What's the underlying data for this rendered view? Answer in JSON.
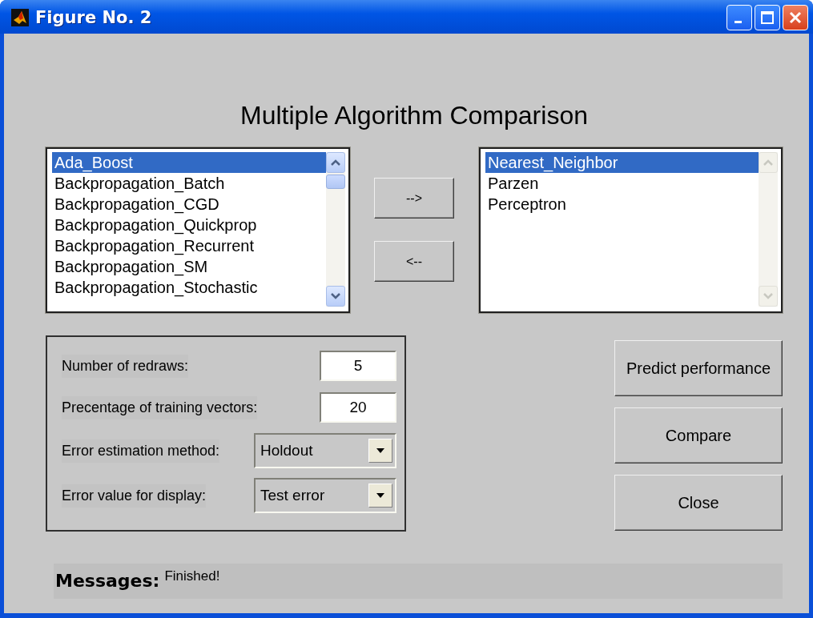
{
  "window": {
    "title": "Figure No. 2"
  },
  "heading": "Multiple Algorithm Comparison",
  "available_list": {
    "scrollbar_disabled": false,
    "items": [
      {
        "label": "Ada_Boost",
        "selected": true
      },
      {
        "label": "Backpropagation_Batch",
        "selected": false
      },
      {
        "label": "Backpropagation_CGD",
        "selected": false
      },
      {
        "label": "Backpropagation_Quickprop",
        "selected": false
      },
      {
        "label": "Backpropagation_Recurrent",
        "selected": false
      },
      {
        "label": "Backpropagation_SM",
        "selected": false
      },
      {
        "label": "Backpropagation_Stochastic",
        "selected": false
      }
    ]
  },
  "move_buttons": [
    "-->",
    "<--"
  ],
  "selected_list": {
    "scrollbar_disabled": true,
    "items": [
      {
        "label": "Nearest_Neighbor",
        "selected": true
      },
      {
        "label": "Parzen",
        "selected": false
      },
      {
        "label": "Perceptron",
        "selected": false
      }
    ]
  },
  "parameters": [
    {
      "kind": "input",
      "label": "Number of redraws:",
      "value": "5"
    },
    {
      "kind": "input",
      "label": "Precentage of training vectors:",
      "value": "20"
    },
    {
      "kind": "dropdown",
      "label": "Error estimation method:",
      "value": "Holdout"
    },
    {
      "kind": "dropdown",
      "label": "Error value for display:",
      "value": "Test error"
    }
  ],
  "actions": [
    "Predict performance",
    "Compare",
    "Close"
  ],
  "messages": {
    "label": "Messages:",
    "text": "Finished!"
  }
}
